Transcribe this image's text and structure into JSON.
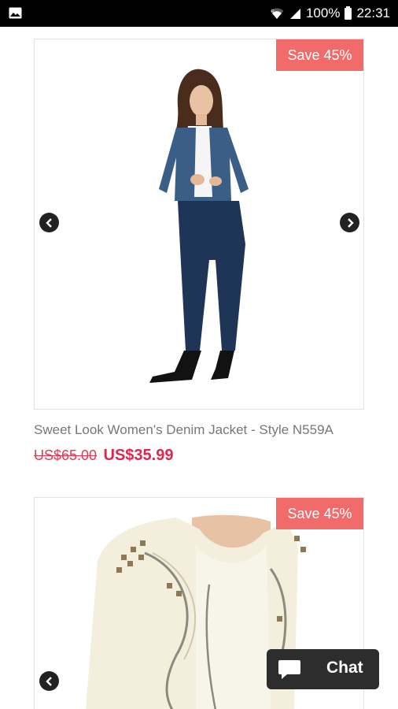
{
  "status_bar": {
    "battery_percent": "100%",
    "time": "22:31",
    "icons": [
      "gallery-icon",
      "wifi-icon",
      "signal-icon",
      "battery-icon"
    ]
  },
  "products": [
    {
      "save_label": "Save 45%",
      "title": "Sweet Look Women's Denim Jacket - Style N559A",
      "old_price": "US$65.00",
      "new_price": "US$35.99"
    },
    {
      "save_label": "Save 45%"
    }
  ],
  "chat": {
    "label": "Chat"
  },
  "colors": {
    "badge": "#f26b6b",
    "price": "#e0254a",
    "chat_bg": "#2d2d2d"
  }
}
